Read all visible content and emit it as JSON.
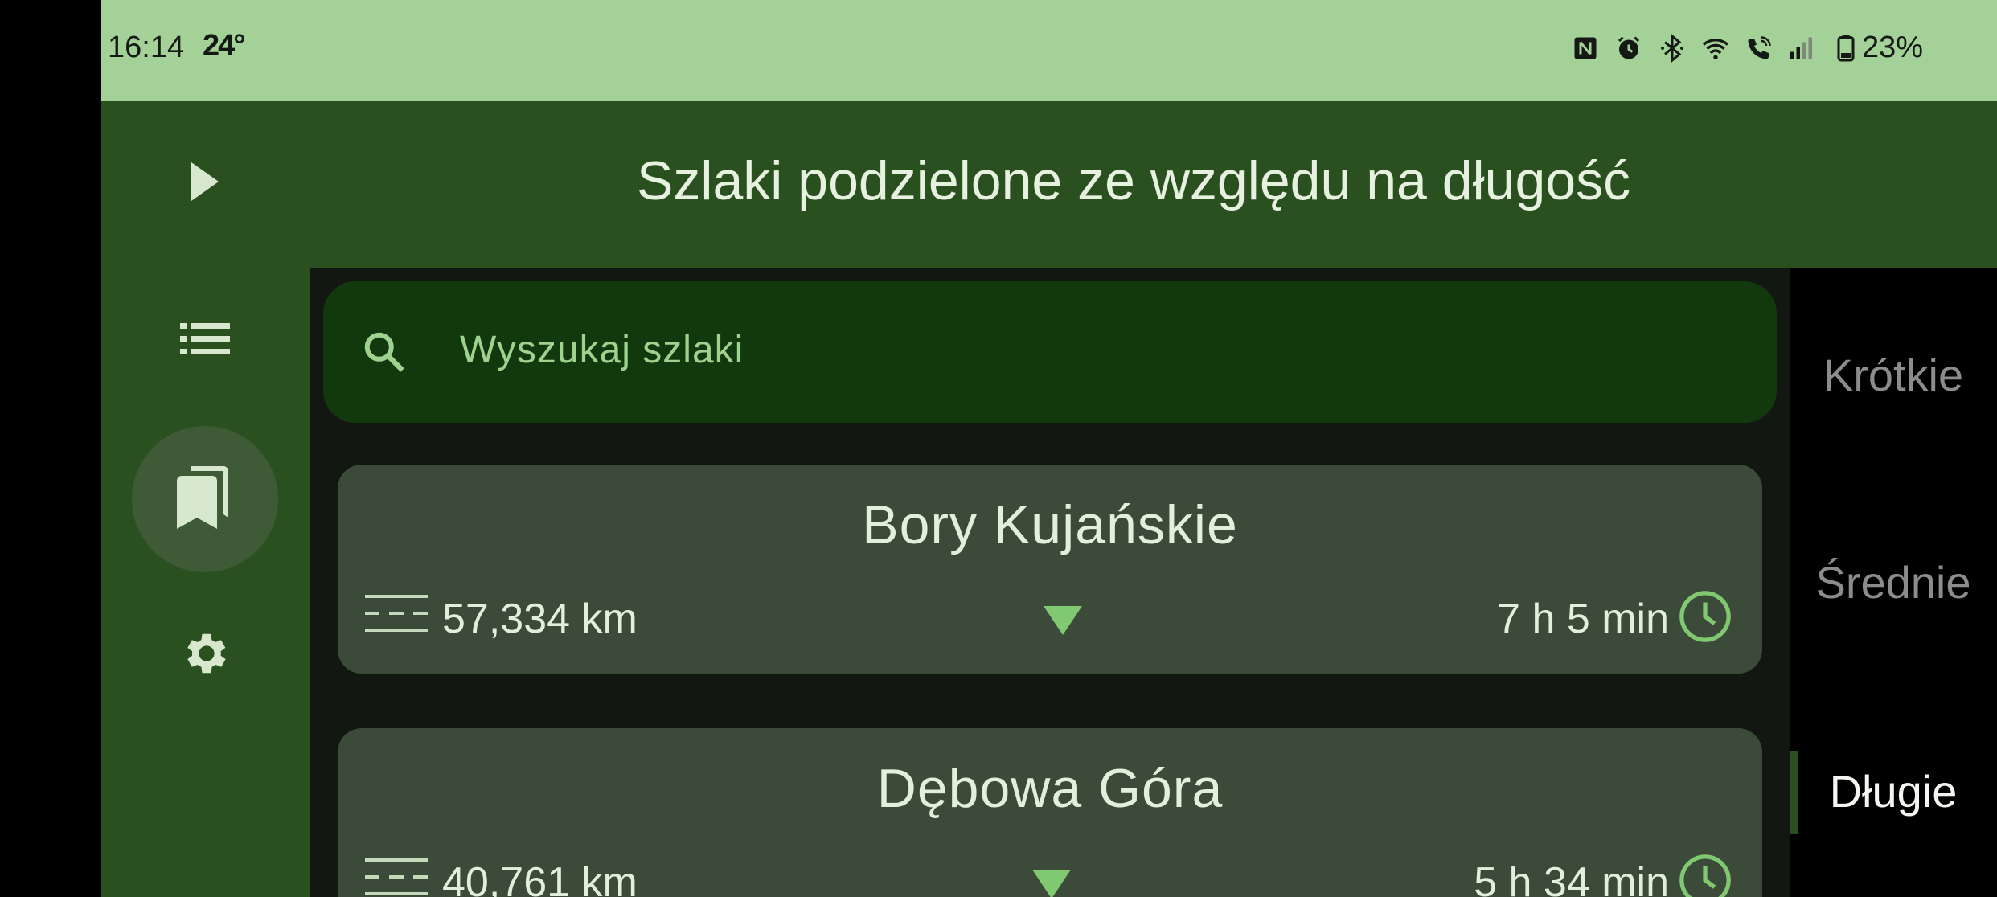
{
  "status_bar": {
    "time": "16:14",
    "temperature": "24°",
    "battery": "23%",
    "icons": [
      "nfc-icon",
      "alarm-icon",
      "bluetooth-icon",
      "wifi-icon",
      "wifi-call-icon",
      "signal-icon",
      "battery-icon"
    ]
  },
  "header": {
    "title": "Szlaki podzielone ze względu na długość"
  },
  "rail": {
    "items": [
      "expand-icon",
      "list-icon",
      "bookmarks-icon",
      "settings-icon"
    ],
    "selected": "bookmarks-icon"
  },
  "search": {
    "placeholder": "Wyszukaj szlaki"
  },
  "trails": [
    {
      "name": "Bory Kujańskie",
      "distance": "57,334 km",
      "duration": "7 h 5 min"
    },
    {
      "name": "Dębowa Góra",
      "distance": "40,761 km",
      "duration": "5 h 34 min"
    }
  ],
  "tabs": [
    {
      "label": "Krótkie"
    },
    {
      "label": "Średnie"
    },
    {
      "label": "Długie"
    }
  ],
  "active_tab": "Długie",
  "colors": {
    "status_bar": "#a3d197",
    "header": "#2b5020",
    "search_bg": "#12380d",
    "card_bg": "#3c4a3a",
    "accent": "#80c970"
  }
}
